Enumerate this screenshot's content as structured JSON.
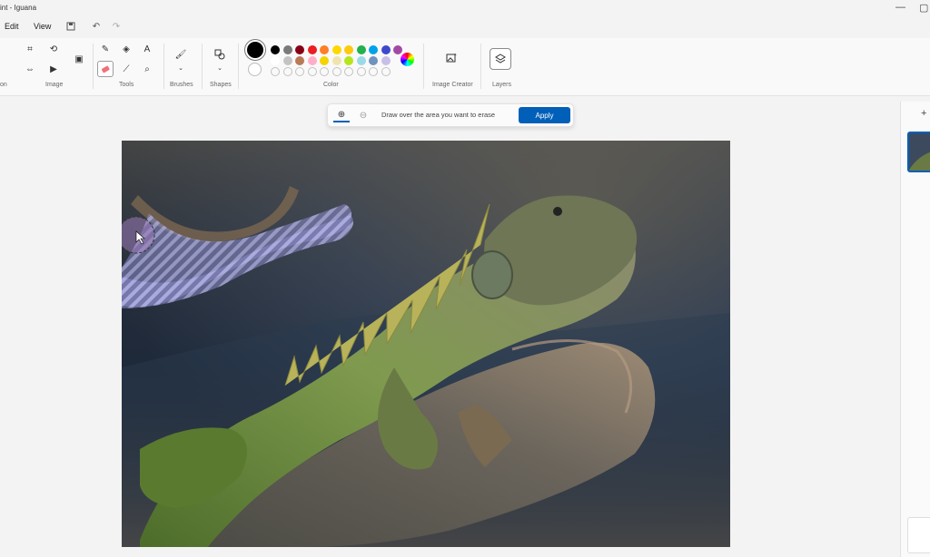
{
  "window": {
    "title": "int - Iguana",
    "minimize": "—",
    "restore": "▢"
  },
  "menu": {
    "edit": "Edit",
    "view": "View",
    "save_icon": "save-icon",
    "undo_icon": "undo-icon",
    "redo_icon": "redo-icon"
  },
  "ribbon": {
    "groups": {
      "selection": "on",
      "image": "Image",
      "tools": "Tools",
      "brushes": "Brushes",
      "shapes": "Shapes",
      "color": "Color",
      "image_creator": "Image Creator",
      "layers": "Layers"
    },
    "selected_tool": "eraser",
    "primary_color": "#000000",
    "secondary_color": "#ffffff",
    "palette_row1": [
      "#000000",
      "#7a7a7a",
      "#880015",
      "#ed1c24",
      "#ff7f27",
      "#ffd800",
      "#ffc90e",
      "#22b14c",
      "#00a2e8",
      "#3f48cc",
      "#a349a4"
    ],
    "palette_row2": [
      "#ffffff",
      "#c3c3c3",
      "#b97a57",
      "#ffaec9",
      "#f5d300",
      "#efe4b0",
      "#b5e61d",
      "#99d9ea",
      "#7092be",
      "#c8bfe7"
    ]
  },
  "erase_bar": {
    "hint": "Draw over the area you want to erase",
    "apply": "Apply"
  },
  "layers_panel": {
    "add_icon": "+"
  }
}
